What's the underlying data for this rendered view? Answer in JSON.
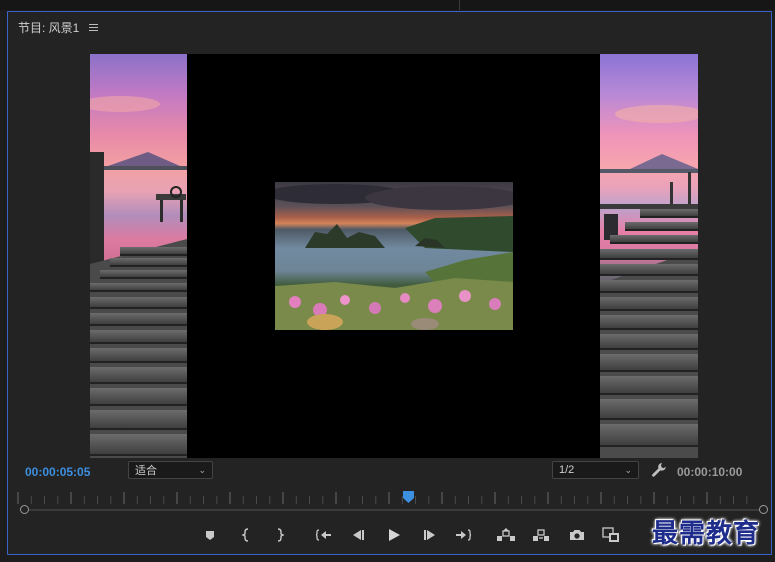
{
  "panel": {
    "title": "节目: 风景1",
    "menu_icon": "hamburger-menu-icon"
  },
  "playback": {
    "current_timecode": "00:00:05:05",
    "duration_timecode": "00:00:10:00",
    "zoom_select": {
      "selected": "适合"
    },
    "resolution_select": {
      "selected": "1/2"
    },
    "playhead_position": 0.52
  },
  "controls": [
    {
      "name": "add-marker-button",
      "icon": "marker-icon"
    },
    {
      "name": "mark-in-button",
      "icon": "mark-in-icon"
    },
    {
      "name": "mark-out-button",
      "icon": "mark-out-icon"
    },
    {
      "name": "go-to-in-button",
      "icon": "go-to-in-icon"
    },
    {
      "name": "step-back-button",
      "icon": "step-back-icon"
    },
    {
      "name": "play-button",
      "icon": "play-icon"
    },
    {
      "name": "step-forward-button",
      "icon": "step-forward-icon"
    },
    {
      "name": "go-to-out-button",
      "icon": "go-to-out-icon"
    },
    {
      "name": "lift-button",
      "icon": "lift-icon"
    },
    {
      "name": "extract-button",
      "icon": "extract-icon"
    },
    {
      "name": "export-frame-button",
      "icon": "camera-icon"
    },
    {
      "name": "comparison-view-button",
      "icon": "comparison-view-icon"
    }
  ],
  "watermark": {
    "text": "最需教育"
  },
  "colors": {
    "accent_blue": "#3d8fe0",
    "panel_border": "#3a64c8",
    "background": "#232323"
  }
}
